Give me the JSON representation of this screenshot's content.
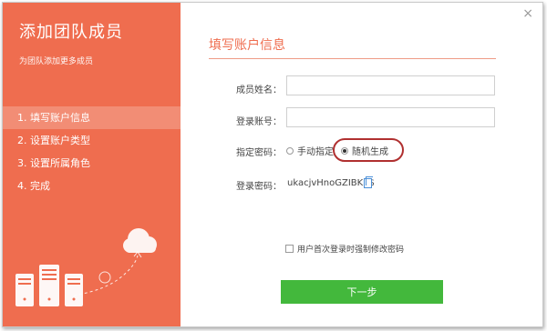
{
  "sidebar": {
    "title": "添加团队成员",
    "subtitle": "为团队添加更多成员",
    "steps": [
      {
        "label": "1. 填写账户信息"
      },
      {
        "label": "2. 设置账户类型"
      },
      {
        "label": "3. 设置所属角色"
      },
      {
        "label": "4. 完成"
      }
    ]
  },
  "main": {
    "title": "填写账户信息",
    "fields": {
      "member_name_label": "成员姓名：",
      "login_account_label": "登录账号：",
      "password_mode_label": "指定密码：",
      "password_label": "登录密码："
    },
    "radio": {
      "manual": "手动指定",
      "random": "随机生成",
      "selected": "随机生成"
    },
    "generated_password": "ukacjvHnoGZIBK3$",
    "force_change_label": "用户首次登录时强制修改密码",
    "next_button": "下一步"
  },
  "close_label": "×",
  "colors": {
    "sidebar": "#ef6d4f",
    "accent": "#ef6d4f",
    "button": "#43b83c",
    "highlight": "#b03030"
  }
}
